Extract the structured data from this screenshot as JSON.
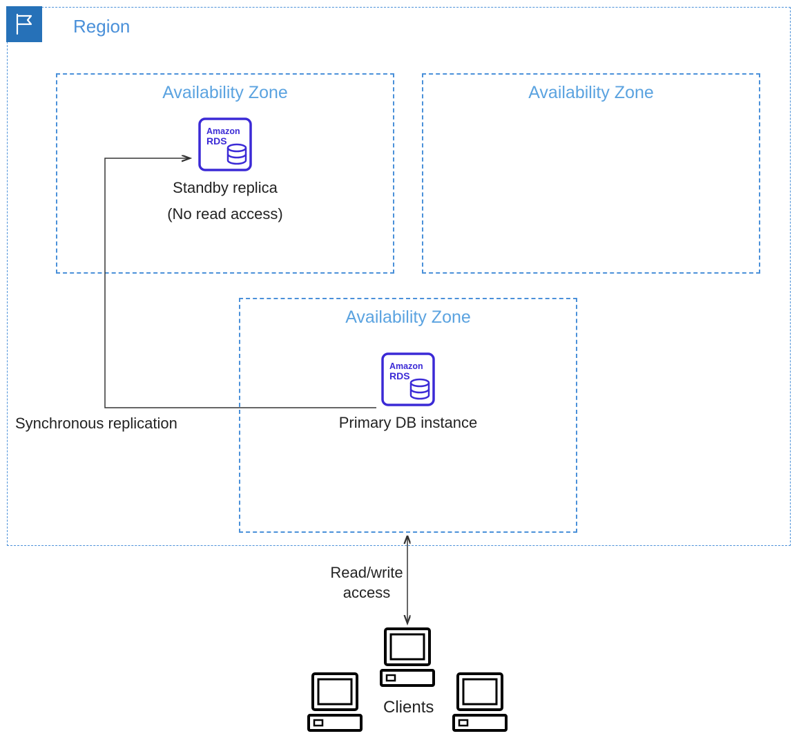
{
  "region": {
    "label": "Region"
  },
  "az1": {
    "label": "Availability Zone"
  },
  "az2": {
    "label": "Availability Zone"
  },
  "az3": {
    "label": "Availability Zone"
  },
  "rds": {
    "product": "Amazon",
    "service": "RDS"
  },
  "standby": {
    "line1": "Standby replica",
    "line2": "(No read access)"
  },
  "primary": {
    "label": "Primary DB instance"
  },
  "replication": {
    "label": "Synchronous replication"
  },
  "readwrite": {
    "line1": "Read/write",
    "line2": "access"
  },
  "clients": {
    "label": "Clients"
  },
  "colors": {
    "border": "#4a90d9",
    "iconBg": "#2671b8",
    "rdsPurple": "#3b2ad6",
    "text": "#232323"
  }
}
